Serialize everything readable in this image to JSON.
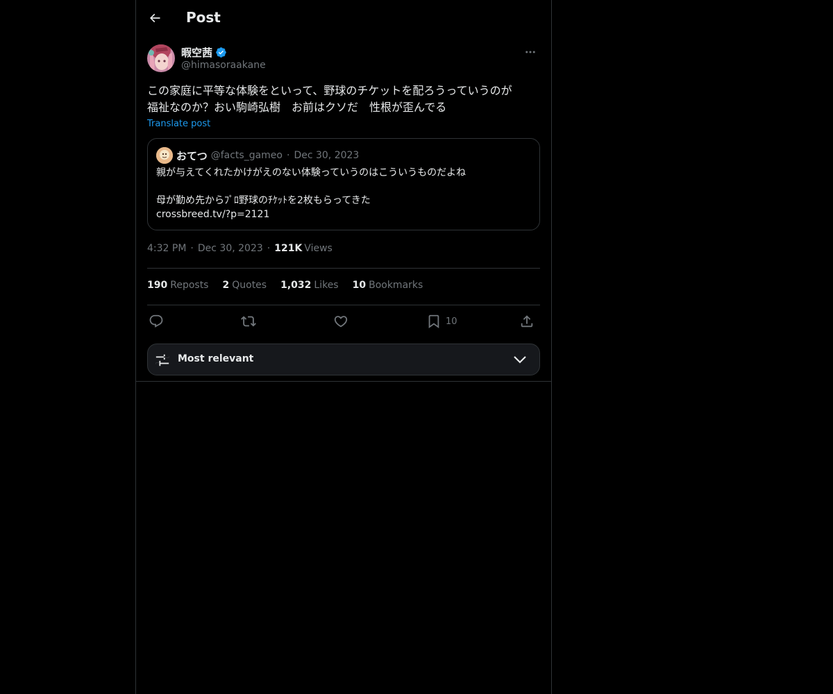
{
  "header": {
    "title": "Post",
    "back_icon": "arrow-left-icon"
  },
  "author": {
    "name": "暇空茜",
    "handle": "@himasoraakane",
    "verified": true,
    "verified_color": "#1d9bf0"
  },
  "post": {
    "text_line1": "この家庭に平等な体験をといって、野球のチケットを配ろうっていうのが",
    "text_line2": "福祉なのか？おい駒崎弘樹　お前はクソだ　性根が歪んでる",
    "translate_label": "Translate post"
  },
  "quote": {
    "name": "おてつ",
    "handle": "@facts_gameo",
    "separator": "·",
    "date": "Dec 30, 2023",
    "line1": "親が与えてくれたかけがえのない体験っていうのはこういうものだよね",
    "line2": "母が勤め先からﾌﾟﾛ野球のﾁｹｯﾄを2枚もらってきた",
    "line3": "crossbreed.tv/?p=2121"
  },
  "meta": {
    "time": "4:32 PM",
    "separator": "·",
    "date": "Dec 30, 2023",
    "views_count": "121K",
    "views_label": "Views"
  },
  "stats": {
    "reposts_count": "190",
    "reposts_label": "Reposts",
    "quotes_count": "2",
    "quotes_label": "Quotes",
    "likes_count": "1,032",
    "likes_label": "Likes",
    "bookmarks_count": "10",
    "bookmarks_label": "Bookmarks"
  },
  "actions": {
    "bookmark_count": "10",
    "icons": [
      "reply-icon",
      "repost-icon",
      "like-icon",
      "bookmark-icon",
      "share-icon"
    ]
  },
  "sort": {
    "label": "Most relevant",
    "icon": "sliders-icon",
    "chevron": "chevron-down-icon"
  },
  "colors": {
    "background": "#000000",
    "border": "#2f3336",
    "text": "#e7e9ea",
    "muted": "#71767b",
    "accent": "#1d9bf0"
  }
}
